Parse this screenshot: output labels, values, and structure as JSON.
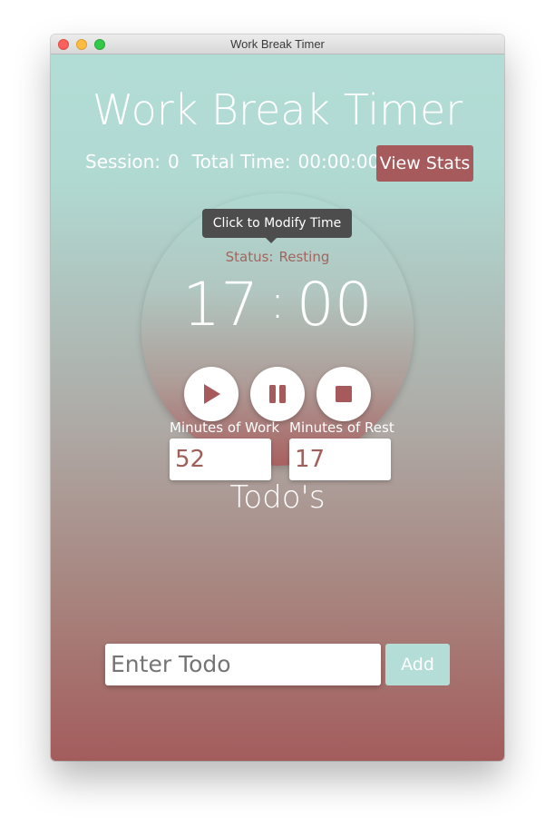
{
  "window": {
    "title": "Work Break Timer"
  },
  "header": {
    "title": "Work Break Timer",
    "session_label": "Session:",
    "session_value": "0",
    "total_time_label": "Total Time:",
    "total_time_value": "00:00:00",
    "view_stats_label": "View Stats"
  },
  "timer": {
    "tooltip": "Click to Modify Time",
    "status_label": "Status:",
    "status_value": "Resting",
    "minutes": "17",
    "separator": ":",
    "seconds": "00",
    "controls": {
      "play_icon": "play-icon",
      "pause_icon": "pause-icon",
      "stop_icon": "stop-icon"
    }
  },
  "settings": {
    "work_label": "Minutes of Work",
    "work_value": "52",
    "rest_label": "Minutes of Rest",
    "rest_value": "17"
  },
  "todos": {
    "heading": "Todo's",
    "input_placeholder": "Enter Todo",
    "add_label": "Add"
  },
  "colors": {
    "accent_red": "#a65a5c",
    "accent_teal": "#b3ddd6",
    "icon_red": "#a65a5c"
  }
}
